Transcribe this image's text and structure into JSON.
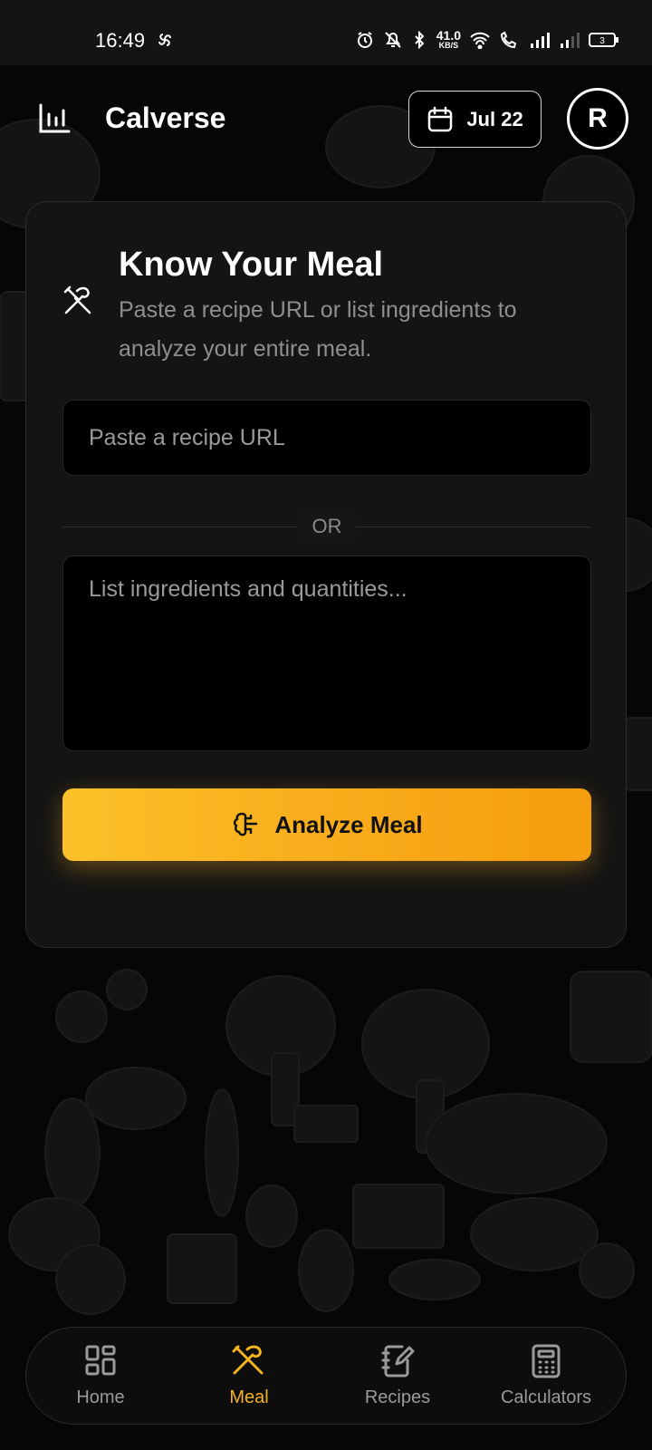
{
  "status_bar": {
    "time": "16:49",
    "net_speed_value": "41.0",
    "net_speed_unit": "KB/S",
    "battery": "3"
  },
  "header": {
    "app_title": "Calverse",
    "date_label": "Jul 22",
    "avatar_initial": "R"
  },
  "card": {
    "title": "Know Your Meal",
    "subtitle": "Paste a recipe URL or list ingredients to analyze your entire meal.",
    "url_placeholder": "Paste a recipe URL",
    "or_label": "OR",
    "ingredients_placeholder": "List ingredients and quantities...",
    "analyze_button": "Analyze Meal"
  },
  "bottom_nav": {
    "items": [
      {
        "label": "Home",
        "icon": "grid-icon",
        "active": false
      },
      {
        "label": "Meal",
        "icon": "utensils-icon",
        "active": true
      },
      {
        "label": "Recipes",
        "icon": "notebook-edit-icon",
        "active": false
      },
      {
        "label": "Calculators",
        "icon": "calculator-icon",
        "active": false
      }
    ]
  },
  "colors": {
    "accent": "#f5b31e",
    "background": "#000000",
    "card": "#141414"
  }
}
